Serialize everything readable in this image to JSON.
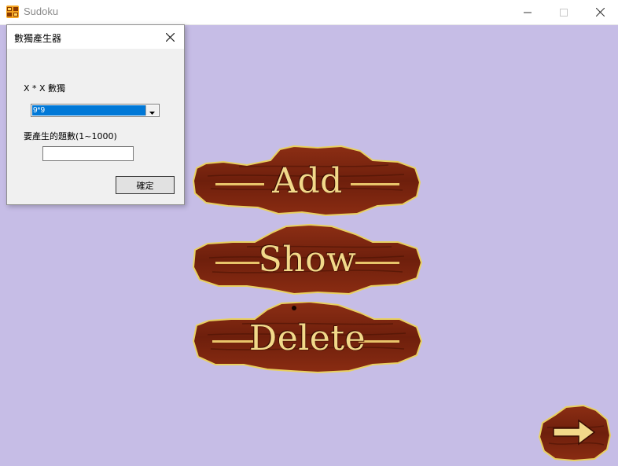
{
  "window": {
    "title": "Sudoku",
    "icon": "sudoku-app-icon",
    "background": "#c6bde6"
  },
  "titlebar_controls": [
    "minimize-icon",
    "maximize-icon",
    "close-icon"
  ],
  "dialog": {
    "title": "數獨產生器",
    "size_label": "X * X 數獨",
    "size_selected": "9*9",
    "count_label": "要產生的題數(1~1000)",
    "count_value": "",
    "ok_label": "確定"
  },
  "menu": {
    "add_label": "Add",
    "show_label": "Show",
    "delete_label": "Delete",
    "next_icon": "arrow-right-icon",
    "wood_color": "#7a2410",
    "text_color": "#f2d98a"
  }
}
